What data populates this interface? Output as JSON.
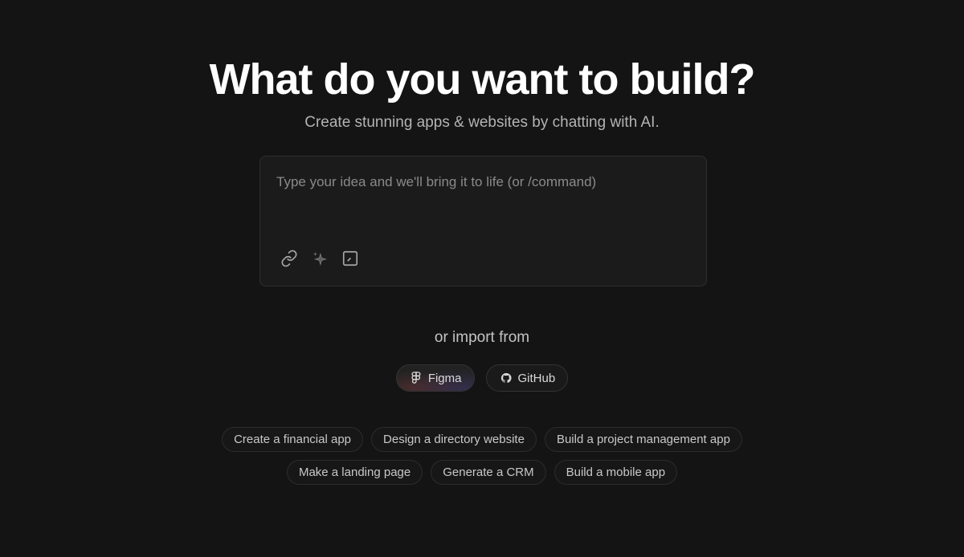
{
  "hero": {
    "title": "What do you want to build?",
    "subtitle": "Create stunning apps & websites by chatting with AI."
  },
  "prompt": {
    "placeholder": "Type your idea and we'll bring it to life (or /command)",
    "value": "",
    "tools": [
      {
        "icon": "link-icon"
      },
      {
        "icon": "sparkles-icon"
      },
      {
        "icon": "edit-square-icon"
      }
    ]
  },
  "import": {
    "label": "or import from",
    "sources": [
      {
        "label": "Figma",
        "icon": "figma-icon"
      },
      {
        "label": "GitHub",
        "icon": "github-icon"
      }
    ]
  },
  "suggestions": {
    "row1": [
      "Create a financial app",
      "Design a directory website",
      "Build a project management app"
    ],
    "row2": [
      "Make a landing page",
      "Generate a CRM",
      "Build a mobile app"
    ]
  },
  "colors": {
    "background": "#141414",
    "accent_glow": "#8296ff",
    "text_primary": "#ffffff",
    "text_muted": "#b3b3b3"
  }
}
